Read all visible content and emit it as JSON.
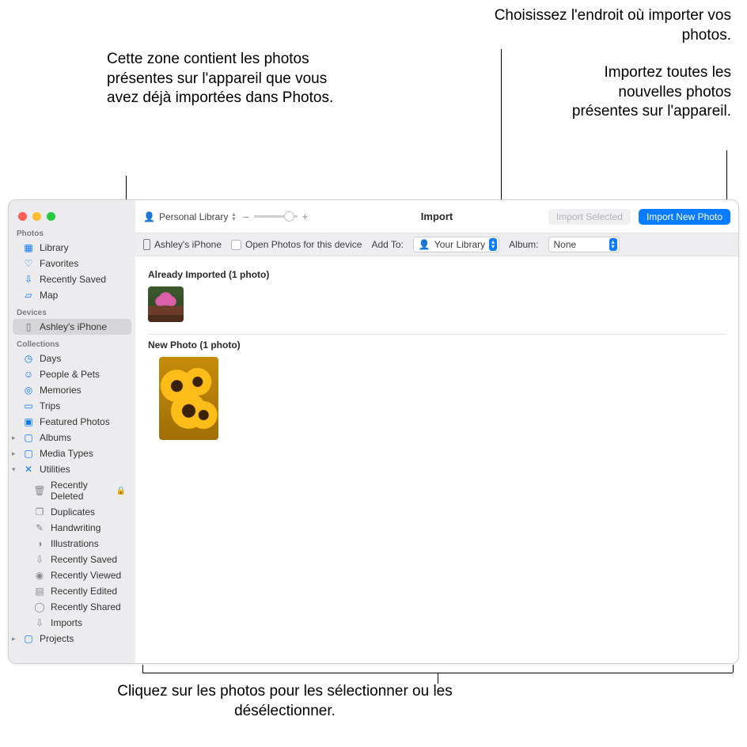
{
  "callouts": {
    "topRight1": "Choisissez l'endroit où importer vos photos.",
    "topRight2": "Importez toutes les nouvelles photos présentes sur l'appareil.",
    "left": "Cette zone contient les photos présentes sur l'appareil que vous avez déjà importées dans Photos.",
    "bottom": "Cliquez sur les photos pour les sélectionner ou les désélectionner."
  },
  "toolbar": {
    "library_label": "Personal Library",
    "zoom_minus": "–",
    "zoom_plus": "+",
    "title": "Import",
    "import_selected": "Import Selected",
    "import_new": "Import New Photo"
  },
  "options": {
    "device_name": "Ashley's iPhone",
    "open_photos_label": "Open Photos for this device",
    "add_to_label": "Add To:",
    "add_to_value": "Your Library",
    "album_label": "Album:",
    "album_value": "None"
  },
  "content_sections": {
    "already_heading": "Already Imported (1 photo)",
    "new_heading": "New Photo (1 photo)"
  },
  "sidebar": {
    "section_photos": "Photos",
    "library": "Library",
    "favorites": "Favorites",
    "recently_saved": "Recently Saved",
    "map": "Map",
    "section_devices": "Devices",
    "device": "Ashley's iPhone",
    "section_collections": "Collections",
    "days": "Days",
    "people_pets": "People & Pets",
    "memories": "Memories",
    "trips": "Trips",
    "featured": "Featured Photos",
    "albums": "Albums",
    "media_types": "Media Types",
    "utilities": "Utilities",
    "recently_deleted": "Recently Deleted",
    "duplicates": "Duplicates",
    "handwriting": "Handwriting",
    "illustrations": "Illustrations",
    "recently_saved2": "Recently Saved",
    "recently_viewed": "Recently Viewed",
    "recently_edited": "Recently Edited",
    "recently_shared": "Recently Shared",
    "imports": "Imports",
    "projects": "Projects"
  }
}
